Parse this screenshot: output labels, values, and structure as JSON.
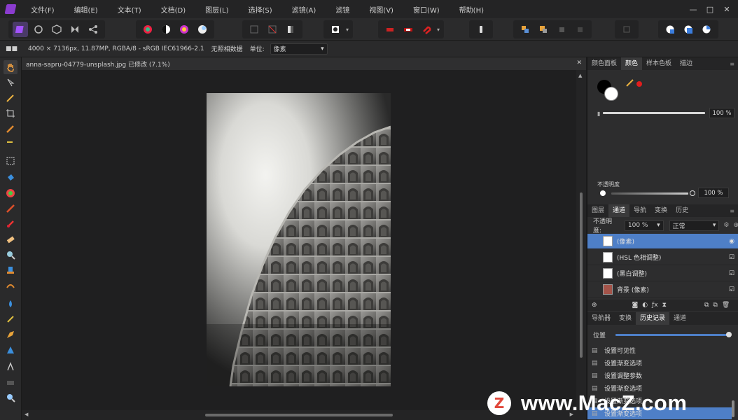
{
  "menu": {
    "items": [
      "文件(F)",
      "编辑(E)",
      "文本(T)",
      "文档(D)",
      "图层(L)",
      "选择(S)",
      "滤镜(A)",
      "滤镜",
      "视图(V)",
      "窗口(W)",
      "帮助(H)"
    ],
    "minimize": "—",
    "maximize": "□",
    "close": "✕"
  },
  "context": {
    "info": "4000 × 7136px, 11.87MP, RGBA/8 - sRGB IEC61966-2.1",
    "label1": "无照相数据",
    "label2": "单位:",
    "unit_value": "像素"
  },
  "document": {
    "tab_title": "anna-sapru-04779-unsplash.jpg 已修改 (7.1%)"
  },
  "color_panel": {
    "tabs": [
      "颜色面板",
      "颜色",
      "样本色板",
      "描边"
    ],
    "active_tab": 1,
    "opacity_value": "100 %",
    "noise_label": "不透明度",
    "noise_value": "100 %",
    "accent": "#e11d1d"
  },
  "layers_panel": {
    "tabs": [
      "图层",
      "通道",
      "导航",
      "变换",
      "历史"
    ],
    "active_tab": 1,
    "opacity_label": "不透明度:",
    "opacity_value": "100 %",
    "blend_mode": "正常",
    "layers": [
      {
        "name": "(像素)",
        "selected": true
      },
      {
        "name": "(HSL 色相调整)",
        "selected": false
      },
      {
        "name": "(黑白调整)",
        "selected": false
      },
      {
        "name": "背景 (像素)",
        "selected": false
      }
    ]
  },
  "history_panel": {
    "tabs": [
      "导航器",
      "变换",
      "历史记录",
      "通道"
    ],
    "active_tab": 2,
    "position_label": "位置",
    "entries": [
      "设置可见性",
      "设置渐变选项",
      "设置调整参数",
      "设置渐变选项",
      "设置渐变选项",
      "设置渐变选项"
    ]
  },
  "watermark": {
    "badge": "Z",
    "text": "www.MacZ.com"
  }
}
